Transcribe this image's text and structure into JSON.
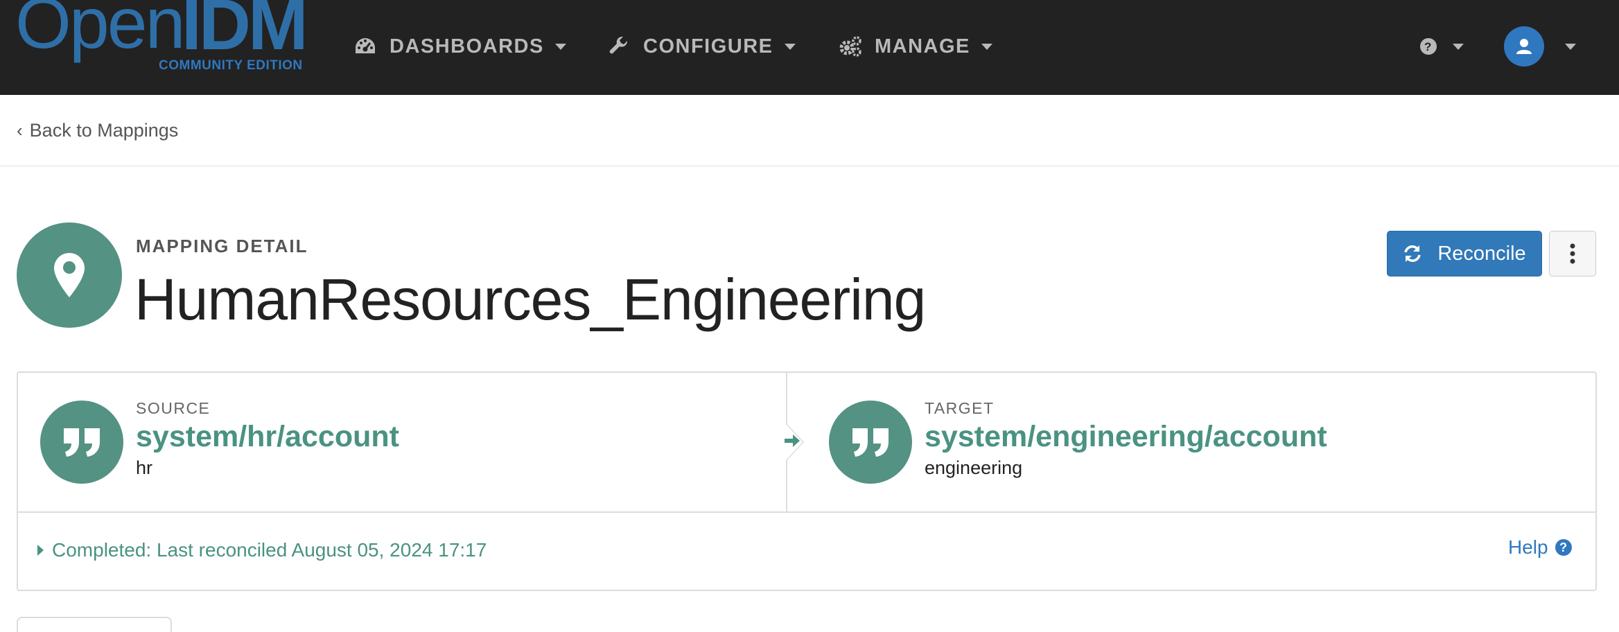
{
  "navbar": {
    "logo_open": "Open",
    "logo_idm": "IDM",
    "logo_edition": "COMMUNITY EDITION",
    "items": [
      {
        "label": "DASHBOARDS",
        "icon": "dashboard-icon"
      },
      {
        "label": "CONFIGURE",
        "icon": "wrench-icon"
      },
      {
        "label": "MANAGE",
        "icon": "gears-icon"
      }
    ],
    "help_icon": "question-circle-icon",
    "user_icon": "user-avatar-icon"
  },
  "back": {
    "label": "Back to Mappings"
  },
  "header": {
    "subtitle": "MAPPING DETAIL",
    "title": "HumanResources_Engineering",
    "icon": "map-marker-icon",
    "reconcile_label": "Reconcile"
  },
  "mapping": {
    "source": {
      "label": "SOURCE",
      "name": "system/hr/account",
      "sub": "hr"
    },
    "target": {
      "label": "TARGET",
      "name": "system/engineering/account",
      "sub": "engineering"
    },
    "status": "Completed: Last reconciled August 05, 2024 17:17",
    "help_label": "Help"
  },
  "colors": {
    "navbar_bg": "#222222",
    "brand_blue": "#2f78c0",
    "teal": "#549283",
    "teal_text": "#4a9281"
  }
}
